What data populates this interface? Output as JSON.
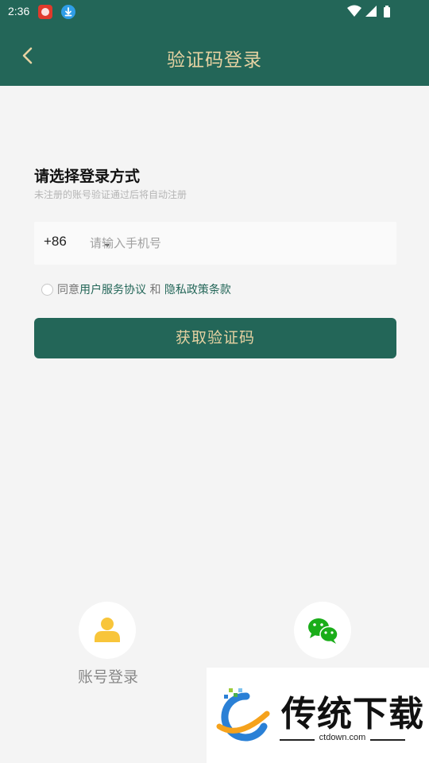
{
  "status_bar": {
    "time": "2:36",
    "notification_icons": [
      "app-notification-icon",
      "download-icon"
    ],
    "system_icons": [
      "wifi-icon",
      "cellular-signal-icon",
      "battery-icon"
    ]
  },
  "app_bar": {
    "back_icon": "chevron-left-icon",
    "title": "验证码登录"
  },
  "login": {
    "heading": "请选择登录方式",
    "subheading": "未注册的账号验证通过后将自动注册",
    "country_code": "+86",
    "phone_placeholder": "请输入手机号",
    "phone_value": "",
    "agree_prefix": "同意",
    "user_agreement_link": "用户服务协议",
    "and_text": " 和 ",
    "privacy_link": "隐私政策条款",
    "agree_checked": false,
    "get_code_button": "获取验证码"
  },
  "alt_login": {
    "account_label": "账号登录",
    "account_icon": "person-icon",
    "wechat_icon": "wechat-icon"
  },
  "watermark": {
    "brand": "传统下载",
    "url": "ctdown.com"
  },
  "colors": {
    "primary": "#236658",
    "title_gold": "#e6d2a2",
    "background": "#f4f4f4",
    "person_icon": "#f8c53a",
    "wechat_green": "#1aad19"
  }
}
